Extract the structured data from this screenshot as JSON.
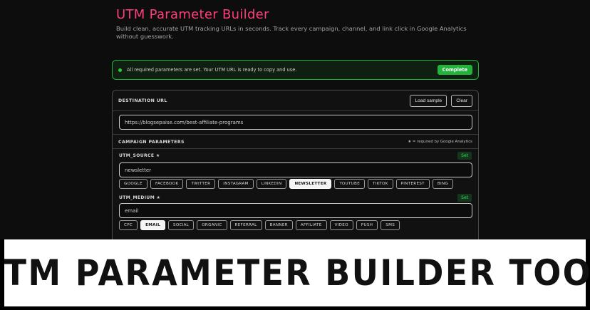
{
  "header": {
    "title": "UTM Parameter Builder",
    "subtitle": "Build clean, accurate UTM tracking URLs in seconds. Track every campaign, channel, and link click in Google Analytics without guesswork."
  },
  "status": {
    "message": "All required parameters are set. Your UTM URL is ready to copy and use.",
    "badge": "Complete",
    "color": "#22b33b"
  },
  "destination": {
    "label": "DESTINATION URL",
    "load_sample": "Load sample",
    "clear": "Clear",
    "value": "https://blogsepaise.com/best-affiliate-programs"
  },
  "campaign": {
    "label": "CAMPAIGN PARAMETERS",
    "required_note": "★ = required by Google Analytics",
    "source": {
      "label": "UTM_SOURCE ★",
      "badge": "Set",
      "value": "newsletter",
      "options": [
        "GOOGLE",
        "FACEBOOK",
        "TWITTER",
        "INSTAGRAM",
        "LINKEDIN",
        "NEWSLETTER",
        "YOUTUBE",
        "TIKTOK",
        "PINTEREST",
        "BING"
      ],
      "selected": "NEWSLETTER"
    },
    "medium": {
      "label": "UTM_MEDIUM ★",
      "badge": "Set",
      "value": "email",
      "options": [
        "CPC",
        "EMAIL",
        "SOCIAL",
        "ORGANIC",
        "REFERRAL",
        "BANNER",
        "AFFILIATE",
        "VIDEO",
        "PUSH",
        "SMS"
      ],
      "selected": "EMAIL"
    }
  },
  "banner": {
    "text": "UTM PARAMETER BUILDER TOOL"
  },
  "colors": {
    "accent": "#ff3f7a",
    "success": "#22b33b",
    "background": "#0d0d0d"
  }
}
